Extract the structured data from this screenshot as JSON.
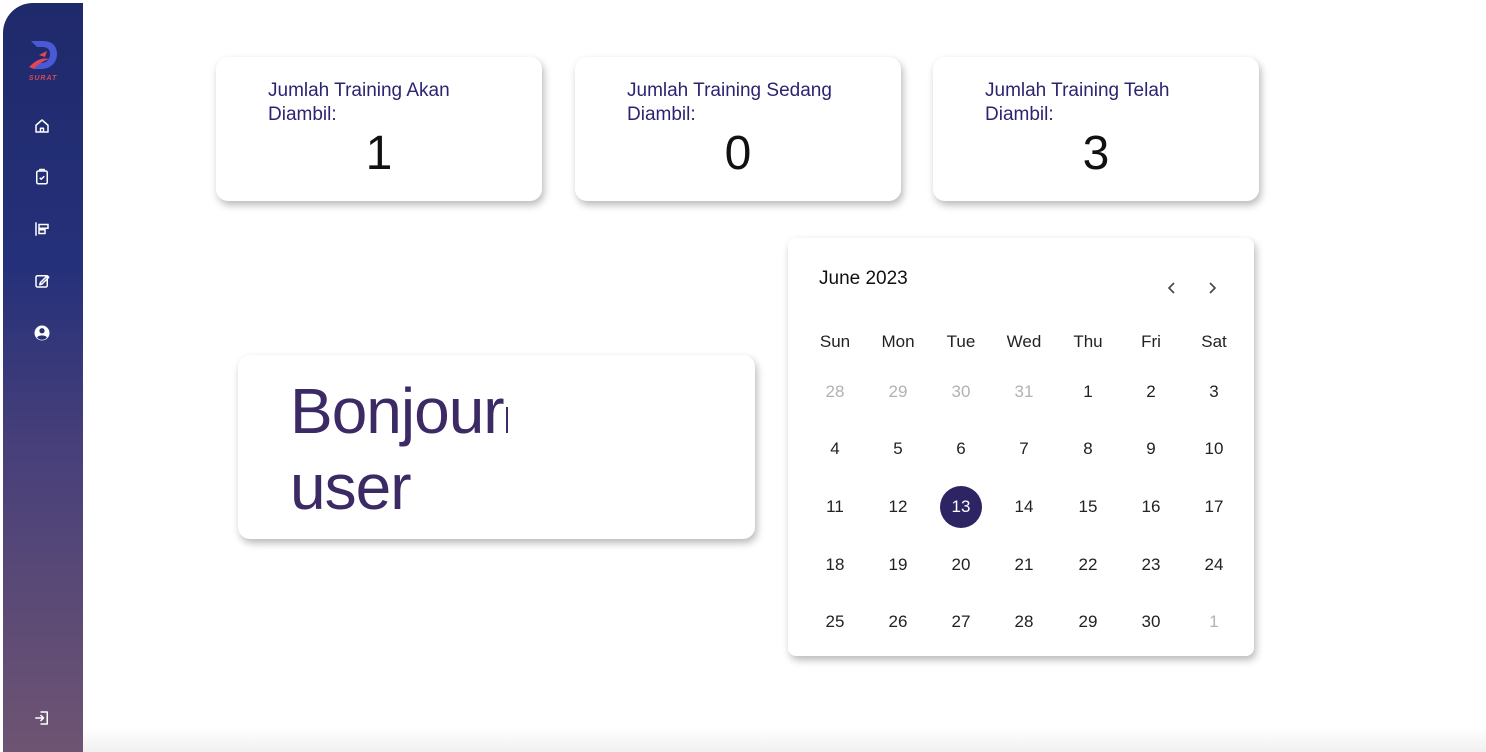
{
  "sidebar": {
    "logo_text": "SURAT",
    "icons": [
      "home-icon",
      "clipboard-check-icon",
      "chart-bars-icon",
      "edit-icon",
      "user-circle-icon",
      "logout-icon"
    ]
  },
  "stats": [
    {
      "label": "Jumlah Training Akan Diambil:",
      "value": "1"
    },
    {
      "label": "Jumlah Training Sedang Diambil:",
      "value": "0"
    },
    {
      "label": "Jumlah Training Telah Diambil:",
      "value": "3"
    }
  ],
  "greeting": {
    "line1": "Bonjour",
    "line2": "user"
  },
  "calendar": {
    "title": "June 2023",
    "weekdays": [
      "Sun",
      "Mon",
      "Tue",
      "Wed",
      "Thu",
      "Fri",
      "Sat"
    ],
    "weeks": [
      [
        {
          "d": "28",
          "muted": true
        },
        {
          "d": "29",
          "muted": true
        },
        {
          "d": "30",
          "muted": true
        },
        {
          "d": "31",
          "muted": true
        },
        {
          "d": "1"
        },
        {
          "d": "2"
        },
        {
          "d": "3"
        }
      ],
      [
        {
          "d": "4"
        },
        {
          "d": "5"
        },
        {
          "d": "6"
        },
        {
          "d": "7"
        },
        {
          "d": "8"
        },
        {
          "d": "9"
        },
        {
          "d": "10"
        }
      ],
      [
        {
          "d": "11"
        },
        {
          "d": "12"
        },
        {
          "d": "13",
          "selected": true
        },
        {
          "d": "14"
        },
        {
          "d": "15"
        },
        {
          "d": "16"
        },
        {
          "d": "17"
        }
      ],
      [
        {
          "d": "18"
        },
        {
          "d": "19"
        },
        {
          "d": "20"
        },
        {
          "d": "21"
        },
        {
          "d": "22"
        },
        {
          "d": "23"
        },
        {
          "d": "24"
        }
      ],
      [
        {
          "d": "25"
        },
        {
          "d": "26"
        },
        {
          "d": "27"
        },
        {
          "d": "28"
        },
        {
          "d": "29"
        },
        {
          "d": "30"
        },
        {
          "d": "1",
          "muted": true
        }
      ]
    ],
    "selected_color": "#2c2463"
  },
  "colors": {
    "sidebar_top": "#1f2a6b",
    "sidebar_bottom": "#6e5472",
    "accent_text": "#2b2470"
  }
}
